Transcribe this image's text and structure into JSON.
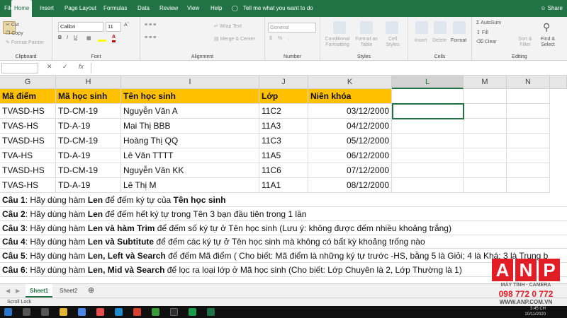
{
  "ribbon_tabs": [
    "File",
    "Home",
    "Insert",
    "Page Layout",
    "Formulas",
    "Data",
    "Review",
    "View",
    "Help"
  ],
  "tell_me": "Tell me what you want to do",
  "share_label": "Share",
  "clipboard": {
    "cut": "Cut",
    "copy": "Copy",
    "format_painter": "Format Painter",
    "group": "Clipboard"
  },
  "font": {
    "name": "Calibri",
    "size": "11",
    "group": "Font"
  },
  "alignment": {
    "wrap_text": "Wrap Text",
    "merge_center": "Merge & Center",
    "group": "Alignment"
  },
  "number": {
    "format": "General",
    "group": "Number"
  },
  "styles": {
    "conditional": "Conditional Formatting",
    "format_table": "Format as Table",
    "cell_styles": "Cell Styles",
    "group": "Styles"
  },
  "cells": {
    "insert": "Insert",
    "delete": "Delete",
    "format": "Format",
    "group": "Cells"
  },
  "editing": {
    "autosum": "AutoSum",
    "fill": "Fill",
    "clear": "Clear",
    "sort_filter": "Sort & Filter",
    "find_select": "Find & Select",
    "group": "Editing"
  },
  "formula_bar": {
    "fx": "fx"
  },
  "columns": [
    "G",
    "H",
    "I",
    "J",
    "K",
    "L",
    "M",
    "N"
  ],
  "table": {
    "headers": [
      "Mã điểm",
      "Mã học sinh",
      "Tên học sinh",
      "Lớp",
      "Niên khóa"
    ],
    "rows": [
      [
        "TVASD-HS",
        "TD-CM-19",
        "Nguyễn Văn A",
        "11C2",
        "03/12/2000"
      ],
      [
        "TVAS-HS",
        "TD-A-19",
        "Mai Thị BBB",
        "11A3",
        "04/12/2000"
      ],
      [
        "TVASD-HS",
        "TD-CM-19",
        "Hoàng Thị QQ",
        "11C3",
        "05/12/2000"
      ],
      [
        "TVA-HS",
        "TD-A-19",
        "Lê Văn TTTT",
        "11A5",
        "06/12/2000"
      ],
      [
        "TVASD-HS",
        "TD-CM-19",
        "Nguyễn Văn KK",
        "11C6",
        "07/12/2000"
      ],
      [
        "TVAS-HS",
        "TD-A-19",
        "Lê Thị M",
        "11A1",
        "08/12/2000"
      ]
    ]
  },
  "questions": [
    {
      "label": "Câu 1",
      "t1": ": Hãy dùng hàm ",
      "b1": "Len",
      "t2": " để đếm ký tự của ",
      "b2": "Tên học sinh",
      "t3": ""
    },
    {
      "label": "Câu 2",
      "t1": ": Hãy dùng hàm ",
      "b1": "Len",
      "t2": " để đếm hết ký tự trong Tên 3 bạn đầu tiên  trong 1 lần",
      "b2": "",
      "t3": ""
    },
    {
      "label": "Câu 3",
      "t1": ": Hãy dùng hàm ",
      "b1": "Len và hàm Trim",
      "t2": " để đếm số ký tự ở Tên học sinh (Lưu ý: không được đếm nhiều khoảng trắng)",
      "b2": "",
      "t3": ""
    },
    {
      "label": "Câu 4",
      "t1": ": Hãy dùng hàm ",
      "b1": "Len và Subtitute",
      "t2": " để đếm các ký tự ở Tên học sinh mà không có bất kỳ khoảng trống nào",
      "b2": "",
      "t3": ""
    },
    {
      "label": "Câu 5",
      "t1": ": Hãy dùng hàm ",
      "b1": "Len, Left và Search",
      "t2": " để đếm Mã điểm ( Cho biết: Mã điểm là những ký tự trước -HS, bằng 5 là Giỏi; 4 là Khá; 3 là Trung b",
      "b2": "",
      "t3": ""
    },
    {
      "label": "Câu 6",
      "t1": ": Hãy dùng hàm ",
      "b1": "Len, Mid và Search",
      "t2": " để lọc ra loại lớp ở Mã học sinh (Cho biết: Lớp Chuyên là 2, Lớp Thường là 1)",
      "b2": "",
      "t3": ""
    }
  ],
  "sheets": [
    "Sheet1",
    "Sheet2"
  ],
  "status": "Scroll Lock",
  "clock": {
    "time": "3:45 CH",
    "date": "10/11/2020"
  },
  "watermark": {
    "letters": [
      "A",
      "N",
      "P"
    ],
    "line1": "MÁY TÍNH · CAMERA",
    "line2": "098 772 0 772",
    "line3": "WWW.ANP.COM.VN"
  },
  "colors": {
    "excel_green": "#217346",
    "header_fill": "#ffc000",
    "logo_red": "#e31d25"
  }
}
